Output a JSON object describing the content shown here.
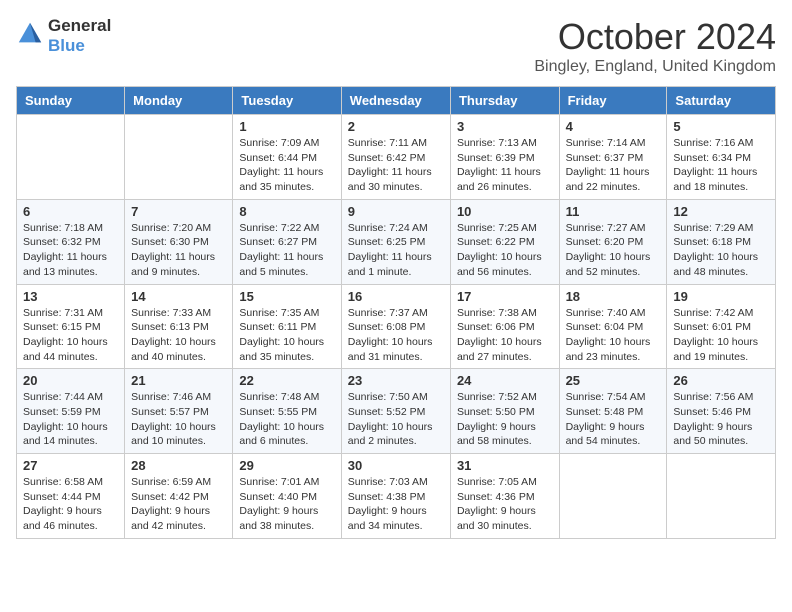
{
  "header": {
    "logo_general": "General",
    "logo_blue": "Blue",
    "month": "October 2024",
    "location": "Bingley, England, United Kingdom"
  },
  "days_of_week": [
    "Sunday",
    "Monday",
    "Tuesday",
    "Wednesday",
    "Thursday",
    "Friday",
    "Saturday"
  ],
  "weeks": [
    [
      {
        "date": "",
        "sunrise": "",
        "sunset": "",
        "daylight": ""
      },
      {
        "date": "",
        "sunrise": "",
        "sunset": "",
        "daylight": ""
      },
      {
        "date": "1",
        "sunrise": "Sunrise: 7:09 AM",
        "sunset": "Sunset: 6:44 PM",
        "daylight": "Daylight: 11 hours and 35 minutes."
      },
      {
        "date": "2",
        "sunrise": "Sunrise: 7:11 AM",
        "sunset": "Sunset: 6:42 PM",
        "daylight": "Daylight: 11 hours and 30 minutes."
      },
      {
        "date": "3",
        "sunrise": "Sunrise: 7:13 AM",
        "sunset": "Sunset: 6:39 PM",
        "daylight": "Daylight: 11 hours and 26 minutes."
      },
      {
        "date": "4",
        "sunrise": "Sunrise: 7:14 AM",
        "sunset": "Sunset: 6:37 PM",
        "daylight": "Daylight: 11 hours and 22 minutes."
      },
      {
        "date": "5",
        "sunrise": "Sunrise: 7:16 AM",
        "sunset": "Sunset: 6:34 PM",
        "daylight": "Daylight: 11 hours and 18 minutes."
      }
    ],
    [
      {
        "date": "6",
        "sunrise": "Sunrise: 7:18 AM",
        "sunset": "Sunset: 6:32 PM",
        "daylight": "Daylight: 11 hours and 13 minutes."
      },
      {
        "date": "7",
        "sunrise": "Sunrise: 7:20 AM",
        "sunset": "Sunset: 6:30 PM",
        "daylight": "Daylight: 11 hours and 9 minutes."
      },
      {
        "date": "8",
        "sunrise": "Sunrise: 7:22 AM",
        "sunset": "Sunset: 6:27 PM",
        "daylight": "Daylight: 11 hours and 5 minutes."
      },
      {
        "date": "9",
        "sunrise": "Sunrise: 7:24 AM",
        "sunset": "Sunset: 6:25 PM",
        "daylight": "Daylight: 11 hours and 1 minute."
      },
      {
        "date": "10",
        "sunrise": "Sunrise: 7:25 AM",
        "sunset": "Sunset: 6:22 PM",
        "daylight": "Daylight: 10 hours and 56 minutes."
      },
      {
        "date": "11",
        "sunrise": "Sunrise: 7:27 AM",
        "sunset": "Sunset: 6:20 PM",
        "daylight": "Daylight: 10 hours and 52 minutes."
      },
      {
        "date": "12",
        "sunrise": "Sunrise: 7:29 AM",
        "sunset": "Sunset: 6:18 PM",
        "daylight": "Daylight: 10 hours and 48 minutes."
      }
    ],
    [
      {
        "date": "13",
        "sunrise": "Sunrise: 7:31 AM",
        "sunset": "Sunset: 6:15 PM",
        "daylight": "Daylight: 10 hours and 44 minutes."
      },
      {
        "date": "14",
        "sunrise": "Sunrise: 7:33 AM",
        "sunset": "Sunset: 6:13 PM",
        "daylight": "Daylight: 10 hours and 40 minutes."
      },
      {
        "date": "15",
        "sunrise": "Sunrise: 7:35 AM",
        "sunset": "Sunset: 6:11 PM",
        "daylight": "Daylight: 10 hours and 35 minutes."
      },
      {
        "date": "16",
        "sunrise": "Sunrise: 7:37 AM",
        "sunset": "Sunset: 6:08 PM",
        "daylight": "Daylight: 10 hours and 31 minutes."
      },
      {
        "date": "17",
        "sunrise": "Sunrise: 7:38 AM",
        "sunset": "Sunset: 6:06 PM",
        "daylight": "Daylight: 10 hours and 27 minutes."
      },
      {
        "date": "18",
        "sunrise": "Sunrise: 7:40 AM",
        "sunset": "Sunset: 6:04 PM",
        "daylight": "Daylight: 10 hours and 23 minutes."
      },
      {
        "date": "19",
        "sunrise": "Sunrise: 7:42 AM",
        "sunset": "Sunset: 6:01 PM",
        "daylight": "Daylight: 10 hours and 19 minutes."
      }
    ],
    [
      {
        "date": "20",
        "sunrise": "Sunrise: 7:44 AM",
        "sunset": "Sunset: 5:59 PM",
        "daylight": "Daylight: 10 hours and 14 minutes."
      },
      {
        "date": "21",
        "sunrise": "Sunrise: 7:46 AM",
        "sunset": "Sunset: 5:57 PM",
        "daylight": "Daylight: 10 hours and 10 minutes."
      },
      {
        "date": "22",
        "sunrise": "Sunrise: 7:48 AM",
        "sunset": "Sunset: 5:55 PM",
        "daylight": "Daylight: 10 hours and 6 minutes."
      },
      {
        "date": "23",
        "sunrise": "Sunrise: 7:50 AM",
        "sunset": "Sunset: 5:52 PM",
        "daylight": "Daylight: 10 hours and 2 minutes."
      },
      {
        "date": "24",
        "sunrise": "Sunrise: 7:52 AM",
        "sunset": "Sunset: 5:50 PM",
        "daylight": "Daylight: 9 hours and 58 minutes."
      },
      {
        "date": "25",
        "sunrise": "Sunrise: 7:54 AM",
        "sunset": "Sunset: 5:48 PM",
        "daylight": "Daylight: 9 hours and 54 minutes."
      },
      {
        "date": "26",
        "sunrise": "Sunrise: 7:56 AM",
        "sunset": "Sunset: 5:46 PM",
        "daylight": "Daylight: 9 hours and 50 minutes."
      }
    ],
    [
      {
        "date": "27",
        "sunrise": "Sunrise: 6:58 AM",
        "sunset": "Sunset: 4:44 PM",
        "daylight": "Daylight: 9 hours and 46 minutes."
      },
      {
        "date": "28",
        "sunrise": "Sunrise: 6:59 AM",
        "sunset": "Sunset: 4:42 PM",
        "daylight": "Daylight: 9 hours and 42 minutes."
      },
      {
        "date": "29",
        "sunrise": "Sunrise: 7:01 AM",
        "sunset": "Sunset: 4:40 PM",
        "daylight": "Daylight: 9 hours and 38 minutes."
      },
      {
        "date": "30",
        "sunrise": "Sunrise: 7:03 AM",
        "sunset": "Sunset: 4:38 PM",
        "daylight": "Daylight: 9 hours and 34 minutes."
      },
      {
        "date": "31",
        "sunrise": "Sunrise: 7:05 AM",
        "sunset": "Sunset: 4:36 PM",
        "daylight": "Daylight: 9 hours and 30 minutes."
      },
      {
        "date": "",
        "sunrise": "",
        "sunset": "",
        "daylight": ""
      },
      {
        "date": "",
        "sunrise": "",
        "sunset": "",
        "daylight": ""
      }
    ]
  ]
}
